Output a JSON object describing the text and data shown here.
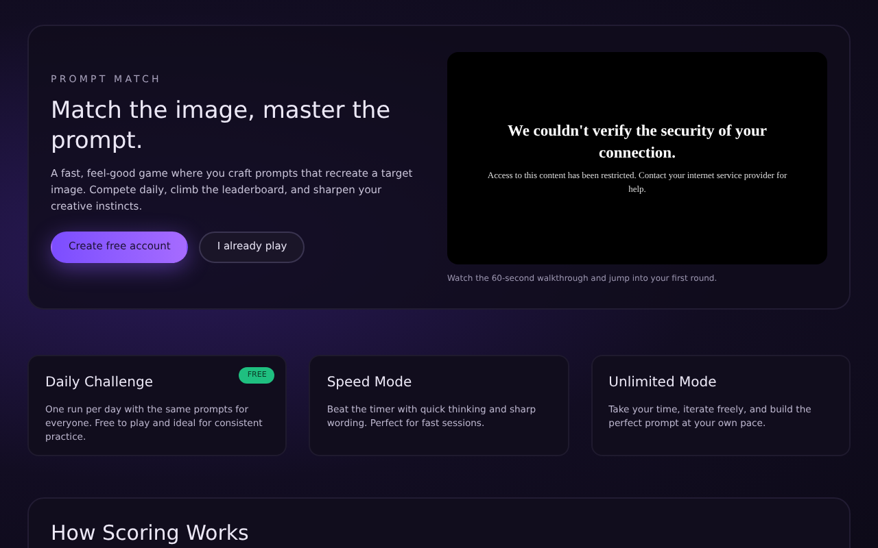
{
  "hero": {
    "eyebrow": "PROMPT MATCH",
    "title": "Match the image, master the prompt.",
    "description": "A fast, feel-good game where you craft prompts that recreate a target image. Compete daily, climb the leaderboard, and sharpen your creative instincts.",
    "buttons": [
      {
        "kind": "primary",
        "label": "Create free account"
      },
      {
        "kind": "secondary",
        "label": "I already play"
      }
    ],
    "embed": {
      "title": "We couldn't verify the security of your connection.",
      "message": "Access to this content has been restricted. Contact your internet service provider for help."
    },
    "caption": "Watch the 60-second walkthrough and jump into your first round."
  },
  "modes": [
    {
      "title": "Daily Challenge",
      "badge": "FREE",
      "description": "One run per day with the same prompts for everyone. Free to play and ideal for consistent practice."
    },
    {
      "title": "Speed Mode",
      "description": "Beat the timer with quick thinking and sharp wording. Perfect for fast sessions."
    },
    {
      "title": "Unlimited Mode",
      "description": "Take your time, iterate freely, and build the perfect prompt at your own pace."
    }
  ],
  "scoring": {
    "title": "How Scoring Works"
  }
}
